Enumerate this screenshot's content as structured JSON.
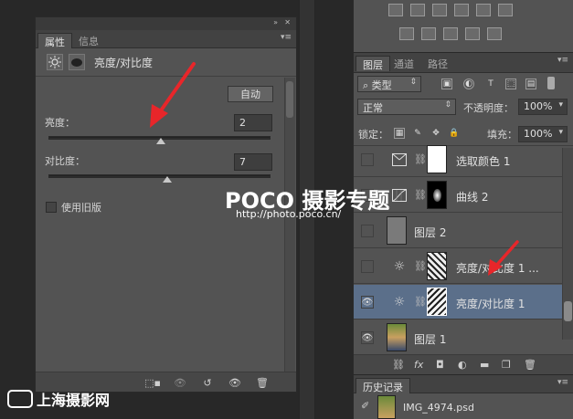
{
  "properties_panel": {
    "tabs": [
      "属性",
      "信息"
    ],
    "title": "亮度/对比度",
    "auto_label": "自动",
    "brightness_label": "亮度：",
    "brightness_value": "2",
    "brightness_level": 0.505,
    "contrast_label": "对比度：",
    "contrast_value": "7",
    "contrast_level": 0.535,
    "legacy_label": "使用旧版"
  },
  "layers_panel": {
    "tabs": [
      "图层",
      "通道",
      "路径"
    ],
    "filter_kind": "类型",
    "blend_mode": "正常",
    "opacity_label": "不透明度：",
    "opacity_value": "100%",
    "lock_label": "锁定：",
    "fill_label": "填充：",
    "fill_value": "100%",
    "layers": [
      {
        "name": "选取颜色 1",
        "visible": false,
        "icon": "selective-color-icon",
        "selected": false
      },
      {
        "name": "曲线 2",
        "visible": false,
        "icon": "curves-icon",
        "selected": false
      },
      {
        "name": "图层 2",
        "visible": false,
        "icon": "gray-layer-thumb",
        "selected": false
      },
      {
        "name": "亮度/对比度 1 ...",
        "visible": false,
        "icon": "brightness-icon",
        "selected": false
      },
      {
        "name": "亮度/对比度 1",
        "visible": true,
        "icon": "brightness-icon",
        "selected": true
      },
      {
        "name": "图层 1",
        "visible": true,
        "icon": "photo-thumb",
        "selected": false
      }
    ]
  },
  "history_panel": {
    "tab": "历史记录",
    "item": "IMG_4974.psd"
  },
  "watermark": {
    "logo": "POCO 摄影专题",
    "url": "http://photo.poco.cn/",
    "bottom_logo": "上海摄影网"
  },
  "colors": {
    "panel_bg": "#535353",
    "selected_row": "#5b6f8a",
    "arrow": "#e8262a"
  }
}
